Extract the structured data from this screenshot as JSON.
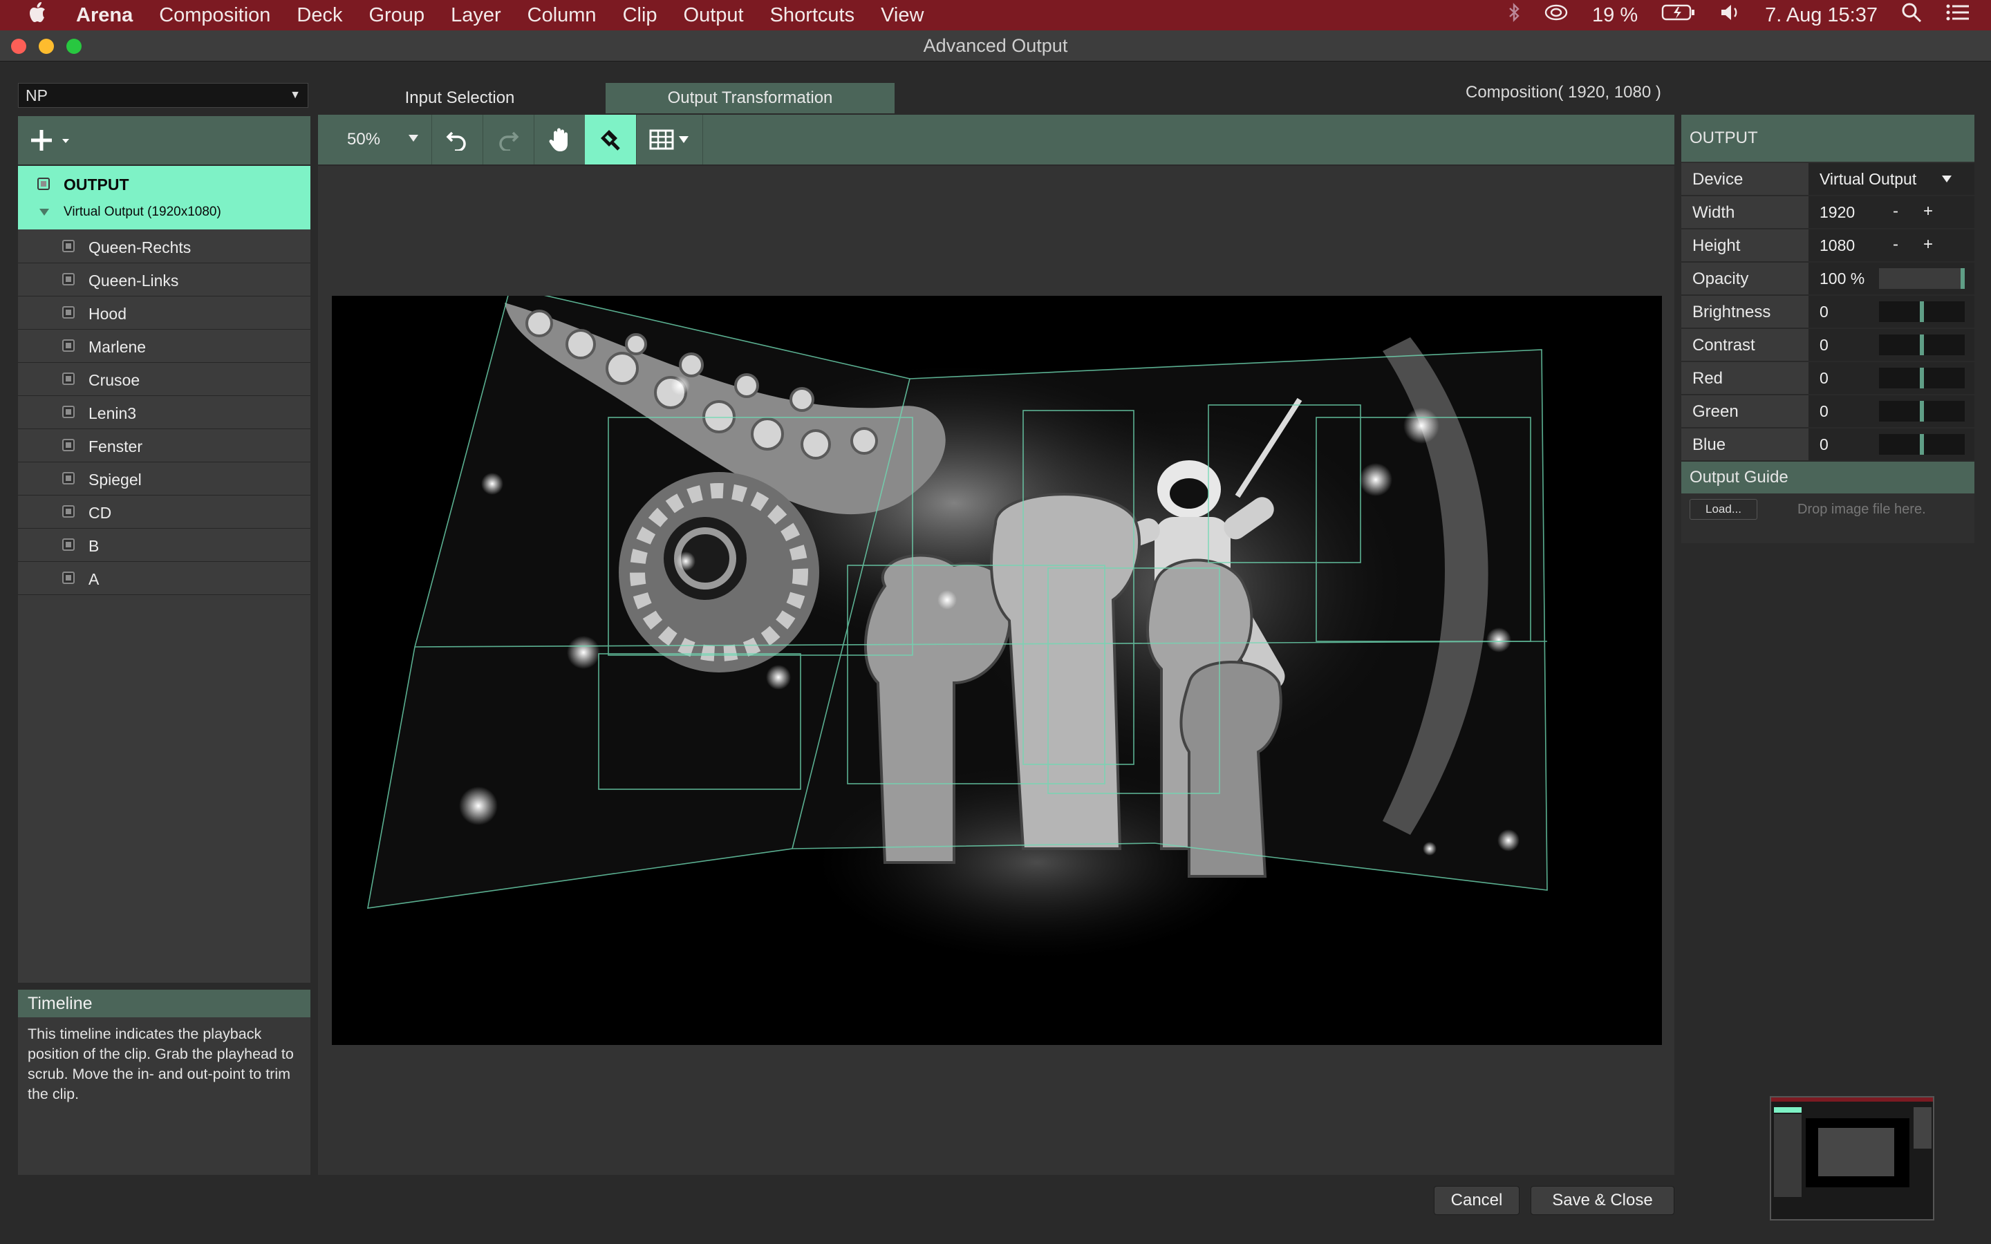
{
  "menubar": {
    "app": "Arena",
    "items": [
      "Composition",
      "Deck",
      "Group",
      "Layer",
      "Column",
      "Clip",
      "Output",
      "Shortcuts",
      "View"
    ],
    "battery": "19 %",
    "clock": "7. Aug  15:37"
  },
  "window": {
    "title": "Advanced Output"
  },
  "left": {
    "preset": "NP",
    "output_label": "OUTPUT",
    "virtual_output": "Virtual Output (1920x1080)",
    "slices": [
      "Queen-Rechts",
      "Queen-Links",
      "Hood",
      "Marlene",
      "Crusoe",
      "Lenin3",
      "Fenster",
      "Spiegel",
      "CD",
      "B",
      "A"
    ]
  },
  "tabs": {
    "input": "Input Selection",
    "output": "Output Transformation"
  },
  "composition_info": "Composition( 1920, 1080 )",
  "toolbar": {
    "zoom": "50%"
  },
  "right": {
    "header": "OUTPUT",
    "device_label": "Device",
    "device_value": "Virtual Output",
    "width_label": "Width",
    "width_value": "1920",
    "height_label": "Height",
    "height_value": "1080",
    "opacity_label": "Opacity",
    "opacity_value": "100 %",
    "brightness_label": "Brightness",
    "brightness_value": "0",
    "contrast_label": "Contrast",
    "contrast_value": "0",
    "red_label": "Red",
    "red_value": "0",
    "green_label": "Green",
    "green_value": "0",
    "blue_label": "Blue",
    "blue_value": "0",
    "minus": "-",
    "plus": "+",
    "guide_header": "Output Guide",
    "load_label": "Load...",
    "drop_text": "Drop image file here."
  },
  "timeline": {
    "title": "Timeline",
    "text": "This timeline indicates the playback position of the clip. Grab the playhead to scrub. Move the in- and out-point to trim the clip."
  },
  "buttons": {
    "cancel": "Cancel",
    "save": "Save & Close"
  },
  "colors": {
    "menubar": "#7c1a22",
    "accent": "#7ef2c6",
    "panel_header": "#4b6559"
  }
}
